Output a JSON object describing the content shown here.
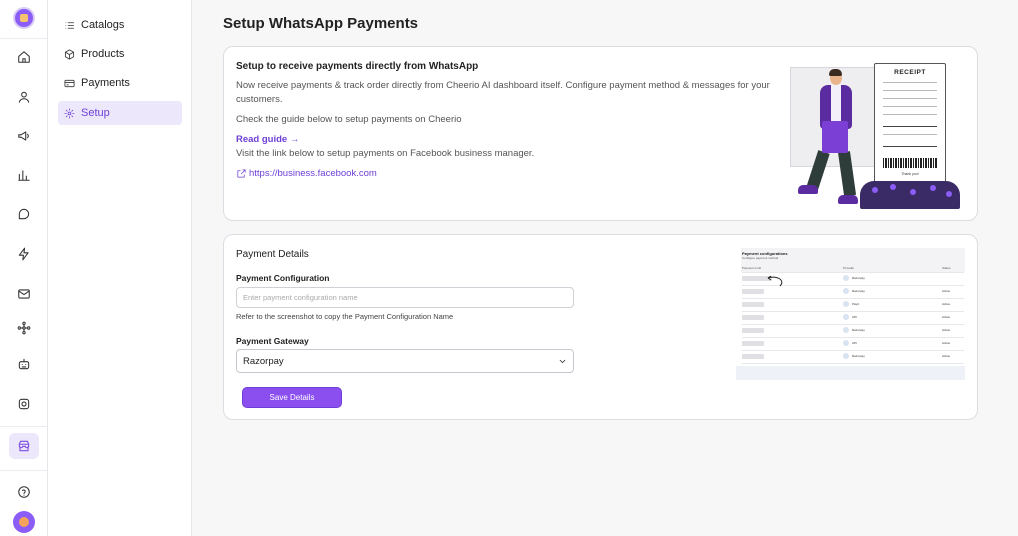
{
  "rail": {
    "icons": [
      "home-icon",
      "user-icon",
      "megaphone-icon",
      "bar-chart-icon",
      "chat-icon",
      "lightning-icon",
      "mail-icon",
      "network-icon",
      "robot-icon",
      "instagram-icon",
      "store-icon",
      "help-icon"
    ]
  },
  "sidebar": {
    "items": [
      {
        "label": "Catalogs",
        "icon": "list-icon"
      },
      {
        "label": "Products",
        "icon": "cube-icon"
      },
      {
        "label": "Payments",
        "icon": "card-icon"
      },
      {
        "label": "Setup",
        "icon": "gear-icon",
        "active": true
      }
    ]
  },
  "page": {
    "title": "Setup WhatsApp Payments"
  },
  "intro": {
    "title": "Setup to receive payments directly from WhatsApp",
    "description": "Now receive payments & track order directly from Cheerio AI dashboard itself. Configure payment method & messages for your customers.",
    "guide_text": "Check the guide below to setup payments on Cheerio",
    "read_guide": "Read guide →",
    "fb_text": "Visit the link below to setup payments on Facebook business manager.",
    "fb_link": "https://business.facebook.com"
  },
  "receipt": {
    "title": "RECEIPT",
    "footer": "Thank you!"
  },
  "payment": {
    "section_title": "Payment Details",
    "config_label": "Payment Configuration",
    "config_value": "",
    "config_placeholder": "Enter payment configuration name",
    "hint": "Refer to the screenshot to copy the Payment Configuration Name",
    "gateway_label": "Payment Gateway",
    "gateway_value": "Razorpay",
    "save_label": "Save Details"
  },
  "reference_shot": {
    "title": "Payment configurations",
    "subtitle": "Configure payment method",
    "col_name": "Payment confi",
    "col_provider": "Provider",
    "col_status": "Status",
    "providers": [
      "Razorpay",
      "Razorpay",
      "PayU",
      "UPI",
      "Razorpay",
      "UPI",
      "Razorpay"
    ],
    "statuses": [
      "",
      "Active",
      "Active",
      "Active",
      "Active",
      "Active",
      "Active"
    ]
  },
  "colors": {
    "accent": "#8b4ff0",
    "accent_dark": "#6d3fd6",
    "active_bg": "#ede7fb"
  }
}
